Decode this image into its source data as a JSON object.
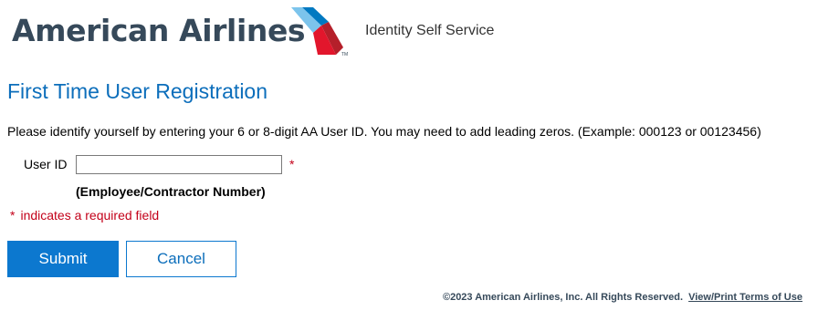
{
  "header": {
    "brand_name": "American Airlines",
    "app_name": "Identity Self Service",
    "trademark": "TM",
    "colors": {
      "brand_text": "#36495A",
      "symbol_blue_light": "#7CC4EC",
      "symbol_blue_dark": "#0079C1",
      "symbol_red": "#E2162C",
      "symbol_red_dark": "#B51F2A"
    }
  },
  "main": {
    "title": "First Time User Registration",
    "instructions": "Please identify yourself by entering your 6 or 8-digit AA User ID. You may need to add leading zeros. (Example: 000123 or 00123456)",
    "user_id_field": {
      "label": "User ID",
      "value": "",
      "placeholder": "",
      "required_marker": "*",
      "hint": "(Employee/Contractor Number)"
    },
    "required_note": {
      "marker": "*",
      "text": "indicates a required field"
    },
    "buttons": {
      "submit_label": "Submit",
      "cancel_label": "Cancel"
    },
    "colors": {
      "title": "#0C6EBB",
      "primary_button": "#0C78CF",
      "required": "#C30019"
    }
  },
  "footer": {
    "copyright": "©2023 American Airlines, Inc. All Rights Reserved.",
    "terms_link": "View/Print Terms of Use"
  }
}
